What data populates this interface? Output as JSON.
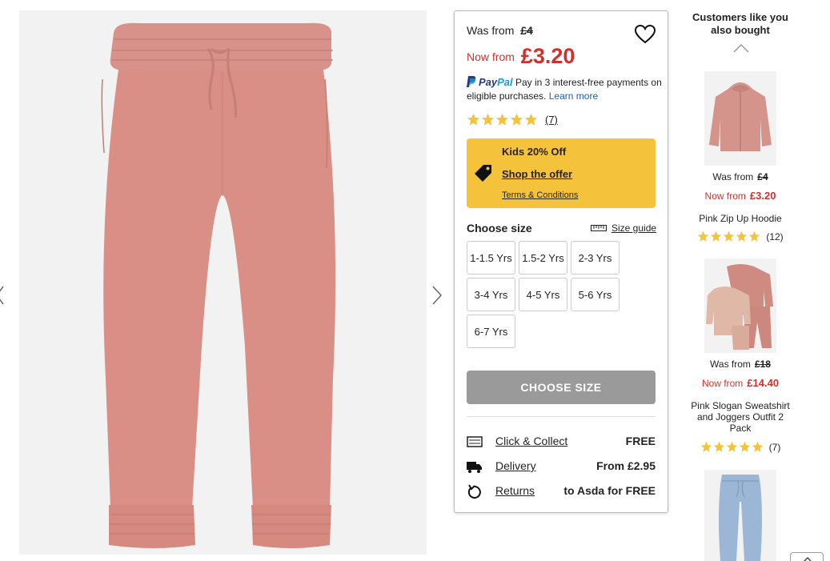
{
  "price": {
    "was_label": "Was from",
    "was_price": "£4",
    "now_label": "Now from",
    "now_price": "£3.20"
  },
  "paypal": {
    "brand_a": "Pay",
    "brand_b": "Pal",
    "text": "Pay in 3 interest-free payments on eligible purchases.",
    "link": "Learn more"
  },
  "rating": {
    "stars": 5,
    "count": "(7)"
  },
  "offer": {
    "title": "Kids 20% Off",
    "link": "Shop the offer",
    "terms": "Terms & Conditions",
    "bg_color": "#f5c33b"
  },
  "sizes": {
    "title": "Choose size",
    "guide": "Size guide",
    "options": [
      "1-1.5 Yrs",
      "1.5-2 Yrs",
      "2-3 Yrs",
      "3-4 Yrs",
      "4-5 Yrs",
      "5-6 Yrs",
      "6-7 Yrs"
    ]
  },
  "cta": {
    "label": "CHOOSE SIZE"
  },
  "fulfilment": [
    {
      "icon": "click-collect-icon",
      "label": "Click & Collect",
      "value": "FREE"
    },
    {
      "icon": "delivery-truck-icon",
      "label": "Delivery",
      "value": "From £2.95"
    },
    {
      "icon": "returns-icon",
      "label": "Returns",
      "value": "to Asda for FREE"
    }
  ],
  "recommendations": {
    "title": "Customers like you also bought",
    "items": [
      {
        "was_label": "Was from",
        "was_price": "£4",
        "now_label": "Now from",
        "now_price": "£3.20",
        "name": "Pink Zip Up Hoodie",
        "count": "(12)"
      },
      {
        "was_label": "Was from",
        "was_price": "£18",
        "now_label": "Now from",
        "now_price": "£14.40",
        "name": "Pink Slogan Sweatshirt and Joggers Outfit 2 Pack",
        "count": "(7)"
      }
    ]
  },
  "colors": {
    "accent_red": "#d0312d",
    "star_gold": "#f5c33b",
    "product_pink": "#d98f86"
  }
}
